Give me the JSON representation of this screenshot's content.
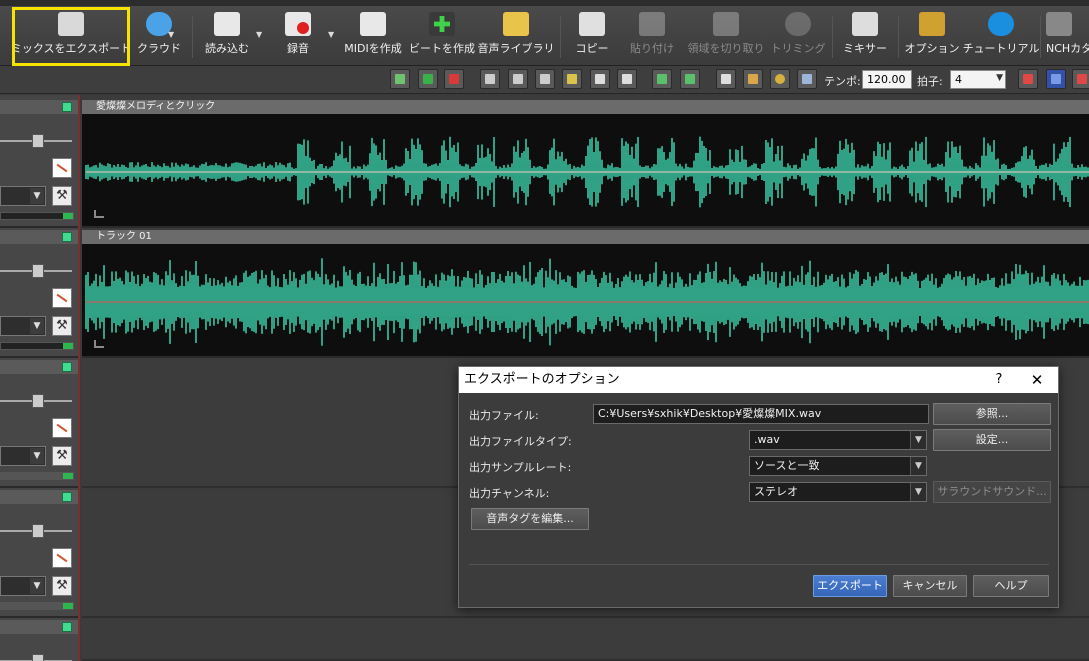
{
  "ribbon": {
    "buttons": [
      {
        "label": "ミックスをエクスポート",
        "icon": "export-mix-icon",
        "disabled": false
      },
      {
        "label": "クラウド",
        "icon": "cloud-icon",
        "disabled": false
      },
      {
        "label": "読み込む",
        "icon": "load-icon",
        "disabled": false
      },
      {
        "label": "録音",
        "icon": "record-icon",
        "disabled": false
      },
      {
        "label": "MIDIを作成",
        "icon": "midi-icon",
        "disabled": false
      },
      {
        "label": "ビートを作成",
        "icon": "beat-icon",
        "disabled": false
      },
      {
        "label": "音声ライブラリ",
        "icon": "sound-library-icon",
        "disabled": false
      },
      {
        "label": "コピー",
        "icon": "copy-icon",
        "disabled": false
      },
      {
        "label": "貼り付け",
        "icon": "paste-icon",
        "disabled": true
      },
      {
        "label": "領域を切り取り",
        "icon": "cut-region-icon",
        "disabled": true
      },
      {
        "label": "トリミング",
        "icon": "trim-icon",
        "disabled": true
      },
      {
        "label": "ミキサー",
        "icon": "mixer-icon",
        "disabled": false
      },
      {
        "label": "オプション",
        "icon": "options-icon",
        "disabled": false
      },
      {
        "label": "チュートリアル",
        "icon": "tutorial-icon",
        "disabled": false
      },
      {
        "label": "NCHカタ",
        "icon": "nch-catalog-icon",
        "disabled": false
      }
    ]
  },
  "toolbar": {
    "tempo_label": "テンポ:",
    "tempo_value": "120.00",
    "beat_label": "拍子:",
    "beat_value": "4"
  },
  "tracks": [
    {
      "name": "愛燦燦メロディとクリック"
    },
    {
      "name": "トラック 01"
    }
  ],
  "dialog": {
    "title": "エクスポートのオプション",
    "help_glyph": "?",
    "close_glyph": "✕",
    "output_file_label": "出力ファイル:",
    "output_file_value": "C:¥Users¥sxhik¥Desktop¥愛燦燦MIX.wav",
    "browse_label": "参照...",
    "file_type_label": "出力ファイルタイプ:",
    "file_type_value": ".wav",
    "settings_label": "設定...",
    "sample_rate_label": "出力サンプルレート:",
    "sample_rate_value": "ソースと一致",
    "channels_label": "出力チャンネル:",
    "channels_value": "ステレオ",
    "surround_label": "サラウンドサウンド...",
    "edit_tags_label": "音声タグを編集...",
    "export_label": "エクスポート",
    "cancel_label": "キャンセル",
    "help_label": "ヘルプ"
  },
  "colors": {
    "waveform": "#3fe0b8",
    "highlight": "#f5e400",
    "primary_button": "#3f72c4"
  }
}
